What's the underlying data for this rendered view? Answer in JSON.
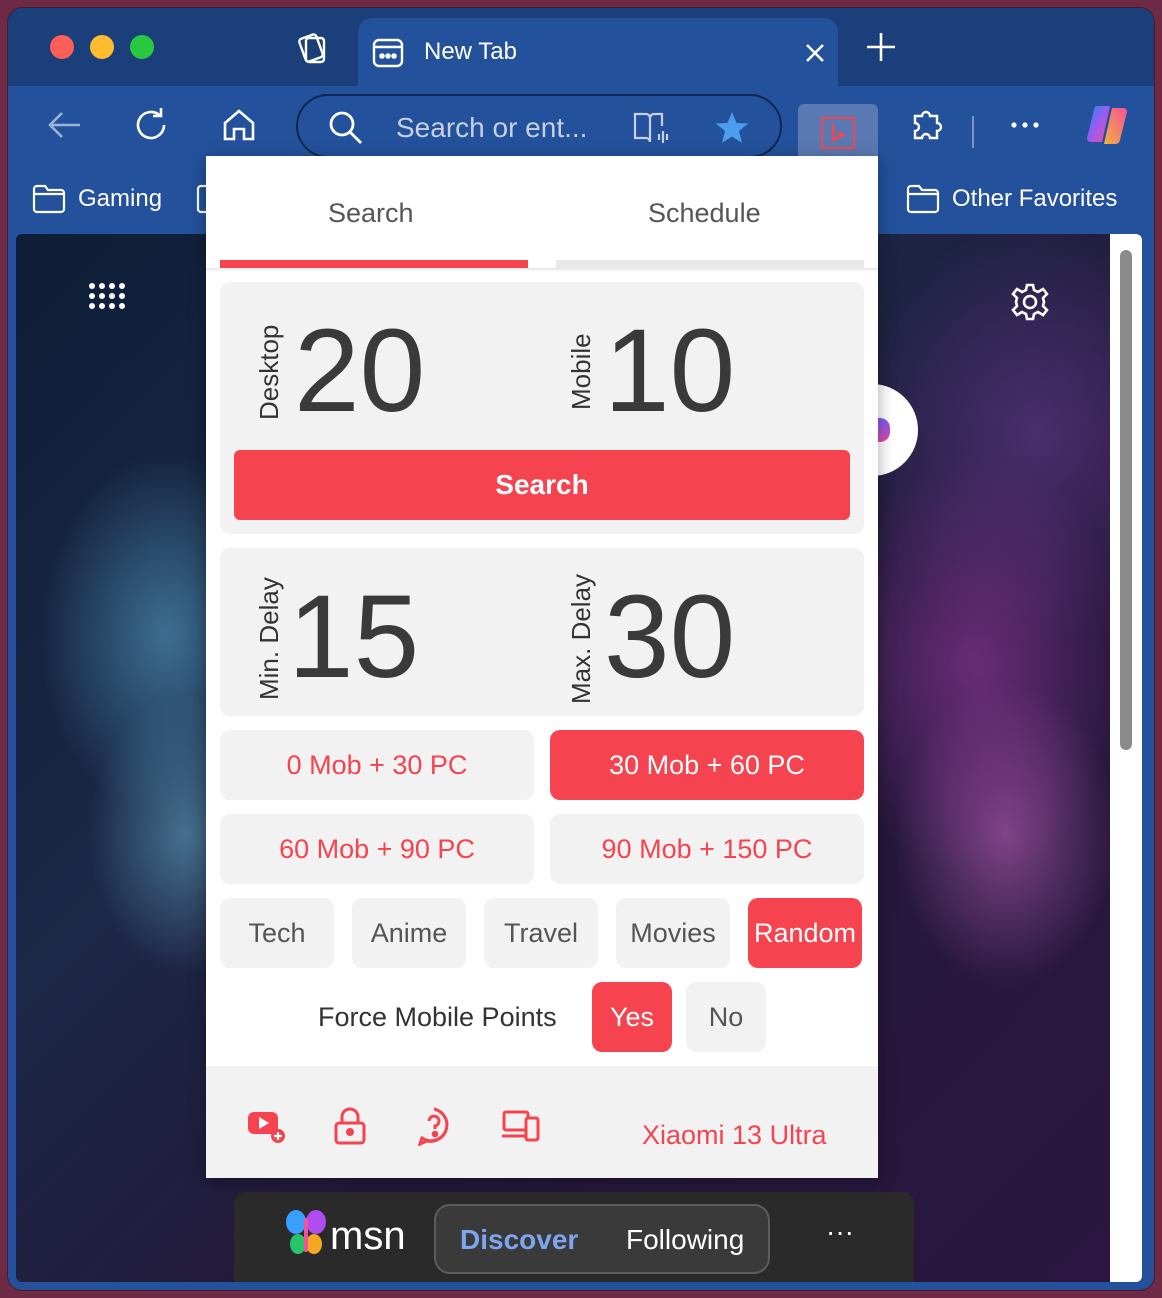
{
  "window": {
    "tab_title": "New Tab",
    "address_placeholder": "Search or ent..."
  },
  "bookmarks": {
    "items": [
      {
        "label": "Gaming"
      },
      {
        "label": "Other Favorites"
      }
    ]
  },
  "popup": {
    "tabs": [
      {
        "label": "Search",
        "active": true
      },
      {
        "label": "Schedule",
        "active": false
      }
    ],
    "counts": {
      "desktop_label": "Desktop",
      "desktop_value": "20",
      "mobile_label": "Mobile",
      "mobile_value": "10",
      "search_button": "Search"
    },
    "delays": {
      "min_label": "Min. Delay",
      "min_value": "15",
      "max_label": "Max. Delay",
      "max_value": "30"
    },
    "presets": [
      {
        "label": "0 Mob + 30 PC",
        "active": false
      },
      {
        "label": "30 Mob + 60 PC",
        "active": true
      },
      {
        "label": "60 Mob + 90 PC",
        "active": false
      },
      {
        "label": "90 Mob + 150 PC",
        "active": false
      }
    ],
    "topics": [
      {
        "label": "Tech",
        "active": false
      },
      {
        "label": "Anime",
        "active": false
      },
      {
        "label": "Travel",
        "active": false
      },
      {
        "label": "Movies",
        "active": false
      },
      {
        "label": "Random",
        "active": true
      }
    ],
    "force_mobile": {
      "label": "Force Mobile Points",
      "yes": "Yes",
      "no": "No",
      "selected": "Yes"
    },
    "footer": {
      "device": "Xiaomi 13 Ultra",
      "icons": [
        "youtube-add-icon",
        "lock-icon",
        "help-icon",
        "devices-icon"
      ]
    }
  },
  "msn": {
    "brand": "msn",
    "tabs": [
      {
        "label": "Discover",
        "active": true
      },
      {
        "label": "Following",
        "active": false
      }
    ],
    "more": "···"
  },
  "colors": {
    "accent": "#f5444f",
    "browser_chrome": "#23519b",
    "tabbar": "#1a3f7a"
  }
}
